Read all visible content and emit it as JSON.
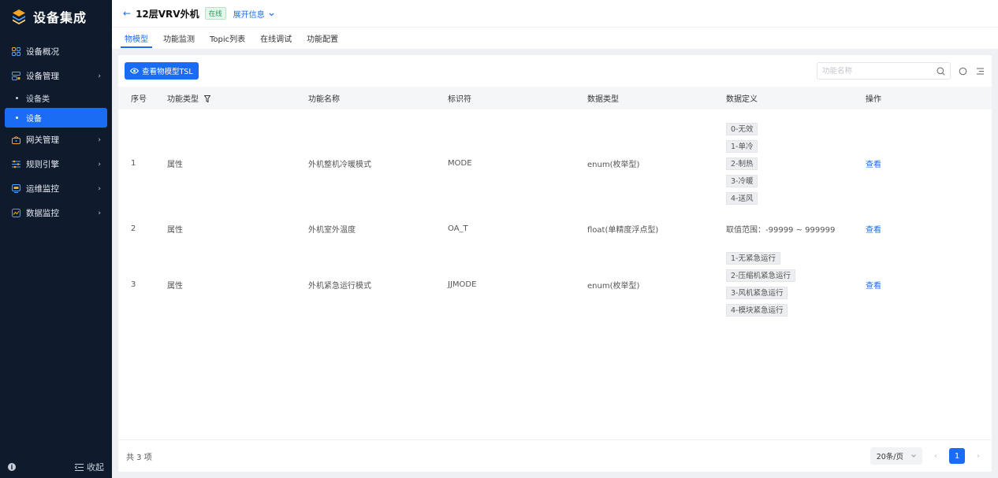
{
  "sidebar": {
    "brand": "设备集成",
    "items": [
      {
        "label": "设备概况",
        "icon": "overview-icon",
        "has_children": false
      },
      {
        "label": "设备管理",
        "icon": "device-manage-icon",
        "has_children": true
      },
      {
        "label": "网关管理",
        "icon": "gateway-icon",
        "has_children": true
      },
      {
        "label": "规则引擎",
        "icon": "rule-engine-icon",
        "has_children": true
      },
      {
        "label": "运维监控",
        "icon": "ops-monitor-icon",
        "has_children": true
      },
      {
        "label": "数据监控",
        "icon": "data-monitor-icon",
        "has_children": true
      }
    ],
    "sub_items": [
      {
        "label": "设备类",
        "active": false
      },
      {
        "label": "设备",
        "active": true
      }
    ],
    "collapse_label": "收起"
  },
  "header": {
    "back_arrow": "←",
    "title": "12层VRV外机",
    "status": "在线",
    "expand_label": "展开信息"
  },
  "tabs": [
    {
      "label": "物模型",
      "active": true
    },
    {
      "label": "功能监测",
      "active": false
    },
    {
      "label": "Topic列表",
      "active": false
    },
    {
      "label": "在线调试",
      "active": false
    },
    {
      "label": "功能配置",
      "active": false
    }
  ],
  "toolbar": {
    "tsl_button": "查看物模型TSL",
    "search_placeholder": "功能名称"
  },
  "table": {
    "columns": [
      "序号",
      "功能类型",
      "功能名称",
      "标识符",
      "数据类型",
      "数据定义",
      "操作"
    ],
    "rows": [
      {
        "index": "1",
        "type": "属性",
        "name": "外机整机冷暖模式",
        "identifier": "MODE",
        "data_type": "enum(枚举型)",
        "definition_tags": [
          "0-无效",
          "1-单冷",
          "2-制热",
          "3-冷暖",
          "4-送风"
        ],
        "definition_text": "",
        "action": "查看"
      },
      {
        "index": "2",
        "type": "属性",
        "name": "外机室外温度",
        "identifier": "OA_T",
        "data_type": "float(单精度浮点型)",
        "definition_tags": [],
        "definition_text": "取值范围：-99999 ~ 999999",
        "action": "查看"
      },
      {
        "index": "3",
        "type": "属性",
        "name": "外机紧急运行模式",
        "identifier": "JJMODE",
        "data_type": "enum(枚举型)",
        "definition_tags": [
          "1-无紧急运行",
          "2-压缩机紧急运行",
          "3-风机紧急运行",
          "4-模块紧急运行"
        ],
        "definition_text": "",
        "action": "查看"
      }
    ]
  },
  "footer": {
    "total": "共 3 项",
    "page_size": "20条/页",
    "current_page": "1"
  },
  "colors": {
    "accent": "#1a6cf5",
    "sidebar_bg": "#0f1b2d",
    "online_green": "#1f9d55"
  }
}
